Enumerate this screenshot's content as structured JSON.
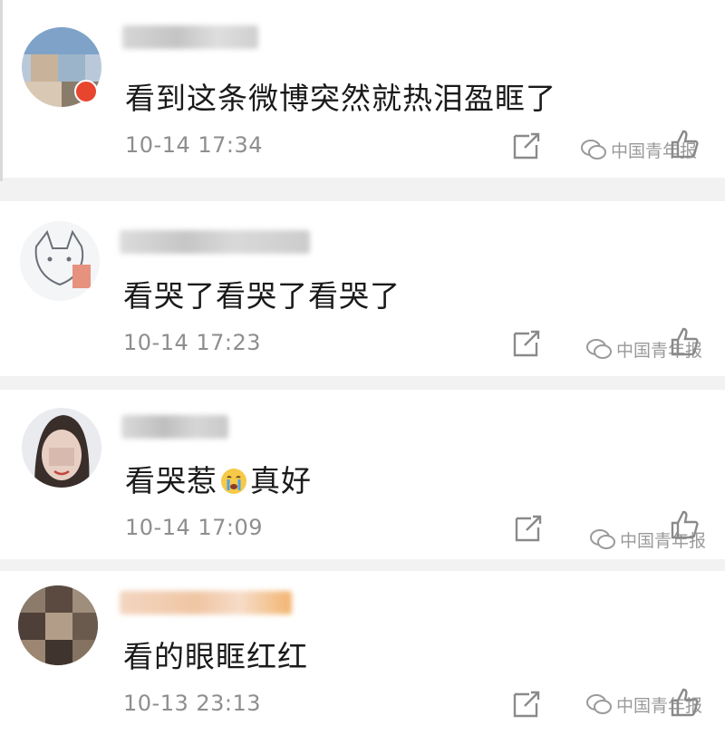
{
  "comments": [
    {
      "text": "看到这条微博突然就热泪盈眶了",
      "time": "10-14 17:34"
    },
    {
      "text": "看哭了看哭了看哭了",
      "time": "10-14 17:23"
    },
    {
      "text_before_emoji": "看哭惹",
      "emoji": "crying-face",
      "text_after_emoji": "真好",
      "time": "10-14 17:09"
    },
    {
      "text": "看的眼眶红红",
      "time": "10-13 23:13"
    }
  ],
  "watermark": {
    "text": "中国青年报",
    "icon": "wechat-icon"
  },
  "icons": {
    "repost": "repost-icon",
    "like": "thumbs-up-icon"
  },
  "colors": {
    "timestamp": "#8e8e8e",
    "badge": "#e8452f",
    "background": "#f2f2f2"
  }
}
